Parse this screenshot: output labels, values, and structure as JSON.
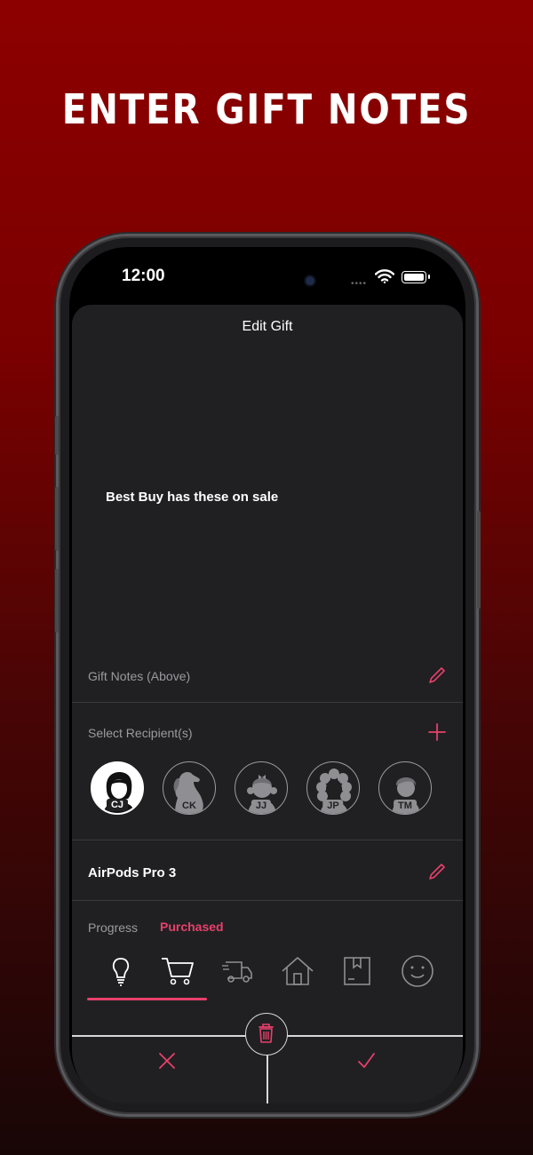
{
  "headline": "ENTER GIFT NOTES",
  "status_bar": {
    "time": "12:00"
  },
  "sheet": {
    "title": "Edit Gift",
    "note_text": "Best Buy has these on sale",
    "gift_notes_label": "Gift Notes (Above)",
    "recipients_label": "Select Recipient(s)",
    "recipients": [
      {
        "initials": "CJ",
        "selected": true
      },
      {
        "initials": "CK",
        "selected": false
      },
      {
        "initials": "JJ",
        "selected": false
      },
      {
        "initials": "JP",
        "selected": false
      },
      {
        "initials": "TM",
        "selected": false
      }
    ],
    "item_name": "AirPods Pro 3",
    "progress_label": "Progress",
    "progress_value": "Purchased",
    "progress_steps": [
      "lightbulb-icon",
      "cart-icon",
      "truck-icon",
      "house-icon",
      "box-icon",
      "smiley-icon"
    ]
  },
  "colors": {
    "accent": "#e8406c",
    "sheet": "#202022",
    "background_top": "#8d0000"
  }
}
